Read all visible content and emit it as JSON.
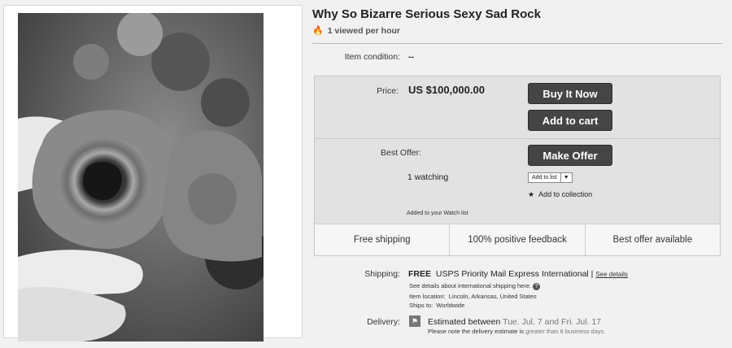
{
  "listing": {
    "title": "Why So Bizarre Serious Sexy Sad Rock",
    "views": "1 viewed per hour"
  },
  "condition": {
    "label": "Item condition:",
    "value": "--"
  },
  "price": {
    "label": "Price:",
    "value": "US $100,000.00"
  },
  "buttons": {
    "buy_now": "Buy It Now",
    "add_to_cart": "Add to cart",
    "make_offer": "Make Offer"
  },
  "offer": {
    "label": "Best Offer:",
    "watching": "1 watching",
    "add_to_list": "Add to list",
    "add_to_collection": "Add to collection",
    "watch_note": "Added to your Watch list"
  },
  "features": [
    "Free shipping",
    "100% positive feedback",
    "Best offer available"
  ],
  "shipping": {
    "label": "Shipping:",
    "free": "FREE",
    "service": "USPS Priority Mail Express International |",
    "see_details": "See details",
    "intl_details": "See details about international shipping here.",
    "location_label": "Item location:",
    "location_value": "Lincoln, Arkansas, United States",
    "ships_label": "Ships to:",
    "ships_value": "Worldwide"
  },
  "delivery": {
    "label": "Delivery:",
    "estimated_label": "Estimated between",
    "dates": "Tue. Jul. 7 and Fri. Jul. 17",
    "note_prefix": "Please note the delivery estimate is",
    "note_highlight": "greater than 6 business days."
  }
}
